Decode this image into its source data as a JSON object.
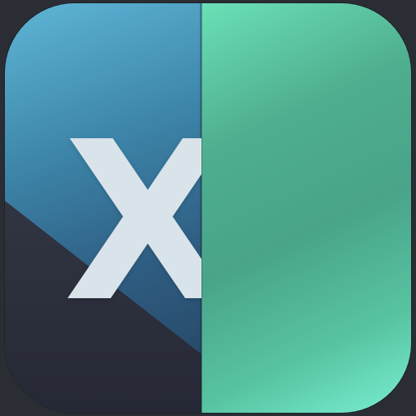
{
  "icon": {
    "letter": "X",
    "colors": {
      "left_top": "#5fb6d6",
      "left_bottom": "#23405f",
      "left_dark": "#2f333f",
      "right_green": "#4fae8f",
      "right_highlight": "#7aefd2",
      "letter": "#d9e4ea",
      "background": "#2a2d33"
    }
  }
}
